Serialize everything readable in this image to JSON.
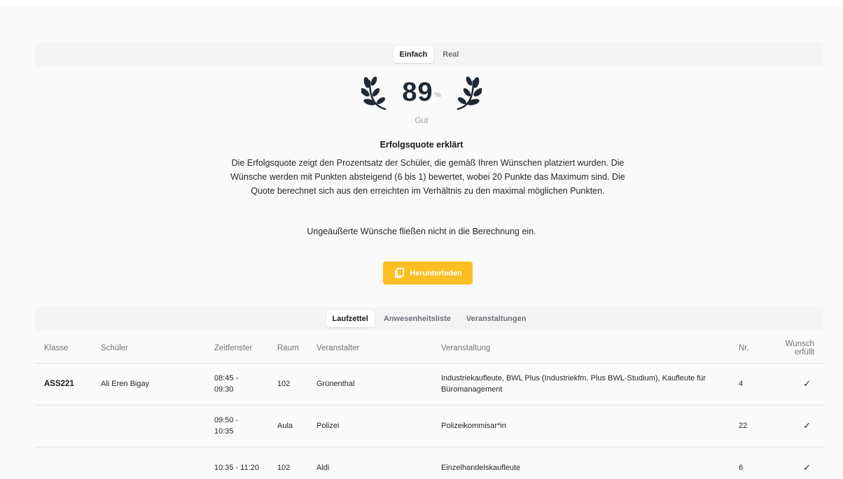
{
  "score_tabs": [
    {
      "label": "Einfach",
      "active": true
    },
    {
      "label": "Real",
      "active": false
    }
  ],
  "score": {
    "value": "89",
    "unit": "%",
    "rating": "Gut"
  },
  "explanation": {
    "title": "Erfolgsquote erklärt",
    "text": "Die Erfolgsquote zeigt den Prozentsatz der Schüler, die gemäß Ihren Wünschen platziert wurden. Die Wünsche werden mit Punkten absteigend (6 bis 1) bewertet, wobei 20 Punkte das Maximum sind. Die Quote berechnet sich aus den erreichten im Verhältnis zu den maximal möglichen Punkten.",
    "note": "Ungeäußerte Wünsche fließen nicht in die Berechnung ein."
  },
  "download_label": "Herunterladen",
  "view_tabs": [
    {
      "label": "Laufzettel",
      "active": true
    },
    {
      "label": "Anwesenheitsliste",
      "active": false
    },
    {
      "label": "Veranstaltungen",
      "active": false
    }
  ],
  "table": {
    "headers": {
      "klasse": "Klasse",
      "schueler": "Schüler",
      "zeitfenster": "Zeitfenster",
      "raum": "Raum",
      "veranstalter": "Veranstalter",
      "veranstaltung": "Veranstaltung",
      "nr": "Nr.",
      "wunsch": "Wunsch erfüllt"
    },
    "rows": [
      {
        "klasse": "ASS221",
        "schueler": "Ali Eren Bigay",
        "zeitfenster": "08:45 - 09:30",
        "raum": "102",
        "veranstalter": "Grünenthal",
        "veranstaltung": "Industriekaufleute, BWL Plus (Industriekfm. Plus BWL-Studium), Kaufleute für Büromanagement",
        "nr": "4",
        "wunsch": "✓"
      },
      {
        "klasse": "",
        "schueler": "",
        "zeitfenster": "09:50 - 10:35",
        "raum": "Aula",
        "veranstalter": "Polizei",
        "veranstaltung": "Polizeikommisar*in",
        "nr": "22",
        "wunsch": "✓"
      },
      {
        "klasse": "",
        "schueler": "",
        "zeitfenster": "10:35 - 11:20",
        "raum": "102",
        "veranstalter": "Aldi",
        "veranstaltung": "Einzelhandelskaufleute",
        "nr": "6",
        "wunsch": "✓"
      }
    ]
  },
  "colors": {
    "accent": "#fbbf24",
    "laurel": "#1f2937"
  },
  "icons": {
    "laurel": "laurel-icon",
    "download": "copy-document-icon",
    "check": "check-icon"
  }
}
